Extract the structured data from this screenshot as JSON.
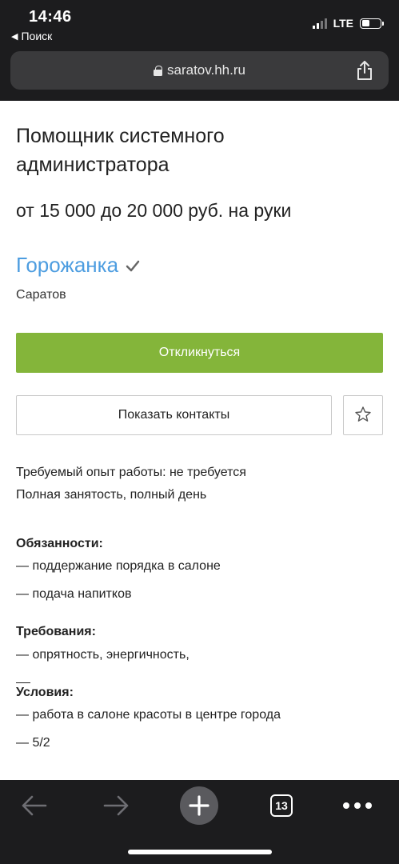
{
  "status_bar": {
    "time": "14:46",
    "back_app": "Поиск",
    "network": "LTE"
  },
  "address_bar": {
    "url": "saratov.hh.ru"
  },
  "vacancy": {
    "title": "Помощник системного администратора",
    "salary": "от 15 000 до 20 000 руб. на руки",
    "company": "Горожанка",
    "city": "Саратов",
    "respond_label": "Откликнуться",
    "contacts_label": "Показать контакты",
    "experience": "Требуемый опыт работы: не требуется",
    "employment": "Полная занятость, полный день"
  },
  "description": {
    "duties_heading": "Обязанности:",
    "duties": [
      "— поддержание порядка в салоне",
      "— подача напитков"
    ],
    "requirements_heading": "Требования:",
    "requirements": [
      "— опрятность, энергичность,"
    ],
    "conditions_heading": "Условия:",
    "conditions": [
      "— работа в салоне красоты в центре города",
      "— 5/2"
    ]
  },
  "toolbar": {
    "tab_count": "13"
  },
  "colors": {
    "accent_green": "#84b53a",
    "link_blue": "#4d9de0",
    "chrome_dark": "#1c1c1e"
  },
  "icons": [
    "back-arrow-icon",
    "forward-arrow-icon",
    "plus-icon",
    "tabs-icon",
    "more-icon",
    "lock-icon",
    "share-icon",
    "star-icon",
    "verified-check-icon"
  ]
}
